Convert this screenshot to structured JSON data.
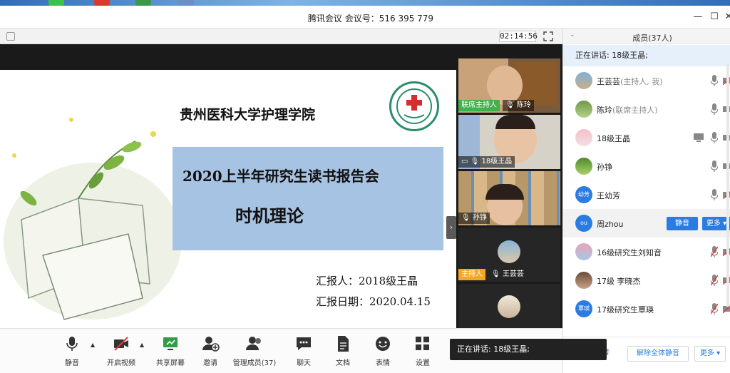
{
  "window": {
    "title": "腾讯会议 会议号：516 395 779"
  },
  "video": {
    "timer": "02:14:56"
  },
  "slide": {
    "school": "贵州医科大学护理学院",
    "title": "2020上半年研究生读书报告会",
    "topic": "时机理论",
    "reporter": "汇报人：2018级王晶",
    "date": "汇报日期：2020.04.15"
  },
  "tiles": [
    {
      "tag": "联席主持人",
      "name": "陈玲"
    },
    {
      "name": "18级王晶"
    },
    {
      "name": "孙铮"
    },
    {
      "tag": "主持人",
      "name": "王芸芸"
    }
  ],
  "toolbar": {
    "mute": "静音",
    "video": "开启视频",
    "share": "共享屏幕",
    "invite": "邀请",
    "manage": "管理成员(37)",
    "chat": "聊天",
    "docs": "文档",
    "emoji": "表情",
    "settings": "设置"
  },
  "toast": "正在讲话: 18级王晶;",
  "panel": {
    "header": "成员(37人)",
    "speaking": "正在讲话: 18级王晶;",
    "members": [
      {
        "name": "王芸芸",
        "sub": "(主持人, 我)"
      },
      {
        "name": "陈玲",
        "sub": "(联席主持人)"
      },
      {
        "name": "18级王晶",
        "sub": ""
      },
      {
        "name": "孙铮",
        "sub": ""
      },
      {
        "name": "王幼芳",
        "sub": "",
        "avatar_text": "幼芳"
      },
      {
        "name": "周zhou",
        "sub": "",
        "avatar_text": "ou"
      },
      {
        "name": "16级研究生刘知音",
        "sub": ""
      },
      {
        "name": "17级 李晓杰",
        "sub": ""
      },
      {
        "name": "17级研究生覃瑛",
        "sub": "",
        "avatar_text": "覃瑛"
      }
    ],
    "mute_btn": "静音",
    "more_btn": "更多 ▾",
    "footer": {
      "mute_all": "音",
      "unmute_all": "解除全体静音",
      "more": "更多 ▾"
    }
  },
  "colors": {
    "accent_blue": "#2a7ce0",
    "host_green": "#3fb24b",
    "host_orange": "#f5a623",
    "slide_band": "#a7c3e3"
  }
}
